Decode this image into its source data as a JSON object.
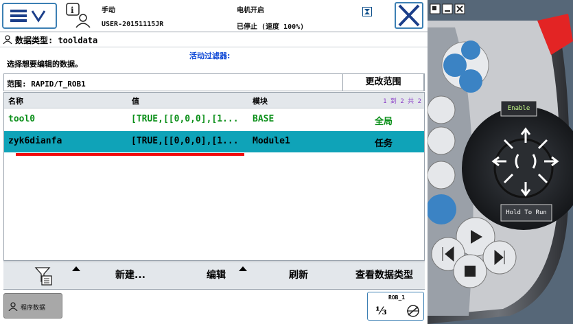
{
  "topbar": {
    "mode_label": "手动",
    "user_label": "USER-20151115JR",
    "motor_label": "电机开启",
    "stopped_label": "已停止 (速度 100%)"
  },
  "datatype": {
    "label": "数据类型: tooldata"
  },
  "filter": {
    "choose_label": "选择想要编辑的数据。",
    "active_filter": "活动过滤器:"
  },
  "scope": {
    "label": "范围: RAPID/T_ROB1",
    "change_button": "更改范围"
  },
  "table": {
    "columns": [
      "名称",
      "值",
      "模块"
    ],
    "pager": "1 到 2 共 2",
    "rows": [
      {
        "name": "tool0",
        "value": "[TRUE,[[0,0,0],[1...",
        "module": "BASE",
        "scope": "全局"
      },
      {
        "name": "zyk6dianfa",
        "value": "[TRUE,[[0,0,0],[1...",
        "module": "Module1",
        "scope": "任务"
      }
    ]
  },
  "toolbar": {
    "new_label": "新建...",
    "edit_label": "编辑",
    "refresh_label": "刷新",
    "view_type_label": "查看数据类型"
  },
  "bottombar": {
    "task_label": "程序数据",
    "rob_label": "ROB_1",
    "fraction": "⅓"
  },
  "flexpendant": {
    "enable_label": "Enable",
    "hold_label": "Hold To Run"
  },
  "colors": {
    "accent_blue": "#3b7fb3",
    "selected_row": "#0fa3b8",
    "module_green": "#0b8f19",
    "red_mark": "#f20b0b",
    "filter_blue": "#0d47d6"
  },
  "icons": [
    "menu-icon",
    "chevron-down-icon",
    "info-user-icon",
    "close-icon",
    "person-icon",
    "filter-icon",
    "task-icon",
    "run-icon"
  ]
}
